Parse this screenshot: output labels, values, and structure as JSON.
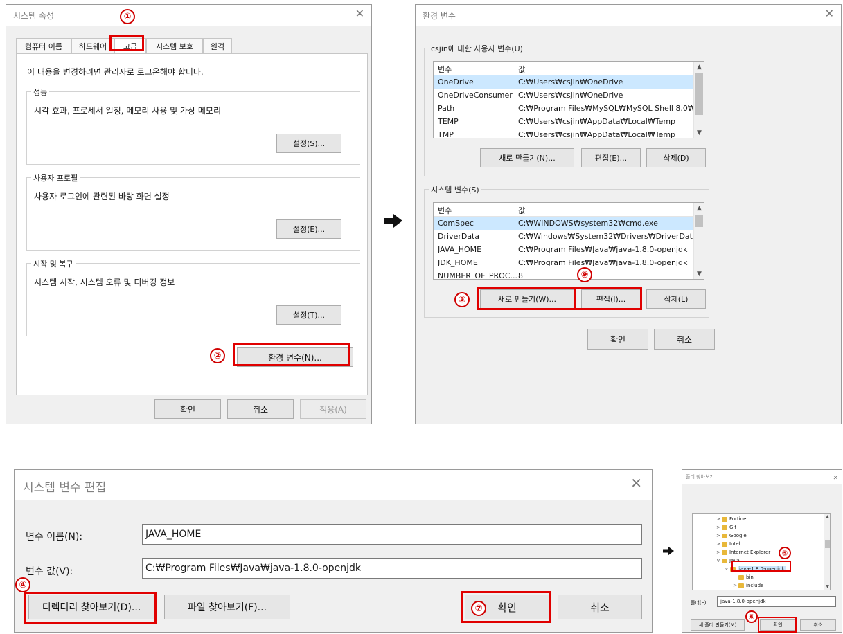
{
  "annotations": {
    "b1": "①",
    "b2": "②",
    "b3": "③",
    "b4": "④",
    "b5": "⑤",
    "b6": "⑥",
    "b7": "⑦",
    "b9": "⑨"
  },
  "sysprops": {
    "title": "시스템 속성",
    "close": "✕",
    "tabs": [
      "컴퓨터 이름",
      "하드웨어",
      "고급",
      "시스템 보호",
      "원격"
    ],
    "notice": "이 내용을 변경하려면 관리자로 로그온해야 합니다.",
    "perf_title": "성능",
    "perf_desc": "시각 효과, 프로세서 일정, 메모리 사용 및 가상 메모리",
    "perf_btn": "설정(S)...",
    "profile_title": "사용자 프로필",
    "profile_desc": "사용자 로그인에 관련된 바탕 화면 설정",
    "profile_btn": "설정(E)...",
    "startup_title": "시작 및 복구",
    "startup_desc": "시스템 시작, 시스템 오류 및 디버깅 정보",
    "startup_btn": "설정(T)...",
    "env_btn": "환경 변수(N)...",
    "ok": "확인",
    "cancel": "취소",
    "apply": "적용(A)"
  },
  "envvars": {
    "title": "환경 변수",
    "close": "✕",
    "user_title": "csjin에 대한 사용자 변수(U)",
    "col_var": "변수",
    "col_val": "값",
    "user_rows": [
      {
        "name": "OneDrive",
        "value": "C:₩Users₩csjin₩OneDrive"
      },
      {
        "name": "OneDriveConsumer",
        "value": "C:₩Users₩csjin₩OneDrive"
      },
      {
        "name": "Path",
        "value": "C:₩Program Files₩MySQL₩MySQL Shell 8.0₩..."
      },
      {
        "name": "TEMP",
        "value": "C:₩Users₩csjin₩AppData₩Local₩Temp"
      },
      {
        "name": "TMP",
        "value": "C:₩Users₩csjin₩AppData₩Local₩Temp"
      }
    ],
    "user_new": "새로 만들기(N)...",
    "user_edit": "편집(E)...",
    "user_delete": "삭제(D)",
    "sys_title": "시스템 변수(S)",
    "sys_rows": [
      {
        "name": "ComSpec",
        "value": "C:₩WINDOWS₩system32₩cmd.exe"
      },
      {
        "name": "DriverData",
        "value": "C:₩Windows₩System32₩Drivers₩DriverData"
      },
      {
        "name": "JAVA_HOME",
        "value": "C:₩Program Files₩Java₩java-1.8.0-openjdk"
      },
      {
        "name": "JDK_HOME",
        "value": "C:₩Program Files₩Java₩java-1.8.0-openjdk"
      },
      {
        "name": "NUMBER_OF_PROC...",
        "value": "8"
      }
    ],
    "sys_new": "새로 만들기(W)...",
    "sys_edit": "편집(I)...",
    "sys_delete": "삭제(L)",
    "ok": "확인",
    "cancel": "취소"
  },
  "editvar": {
    "title": "시스템 변수 편집",
    "close": "✕",
    "name_label": "변수 이름(N):",
    "name_value": "JAVA_HOME",
    "value_label": "변수 값(V):",
    "value_value": "C:₩Program Files₩Java₩java-1.8.0-openjdk",
    "browse_dir": "디렉터리 찾아보기(D)...",
    "browse_file": "파일 찾아보기(F)...",
    "ok": "확인",
    "cancel": "취소"
  },
  "folder": {
    "title": "폴더 찾아보기",
    "close": "✕",
    "items": [
      "Fortinet",
      "Git",
      "Google",
      "Intel",
      "Internet Explorer",
      "Java",
      "java-1.8.0-openjdk",
      "bin",
      "include"
    ],
    "folder_label": "폴더(F):",
    "folder_value": "java-1.8.0-openjdk",
    "new_folder": "새 폴더 만들기(M)",
    "ok": "확인",
    "cancel": "취소"
  }
}
